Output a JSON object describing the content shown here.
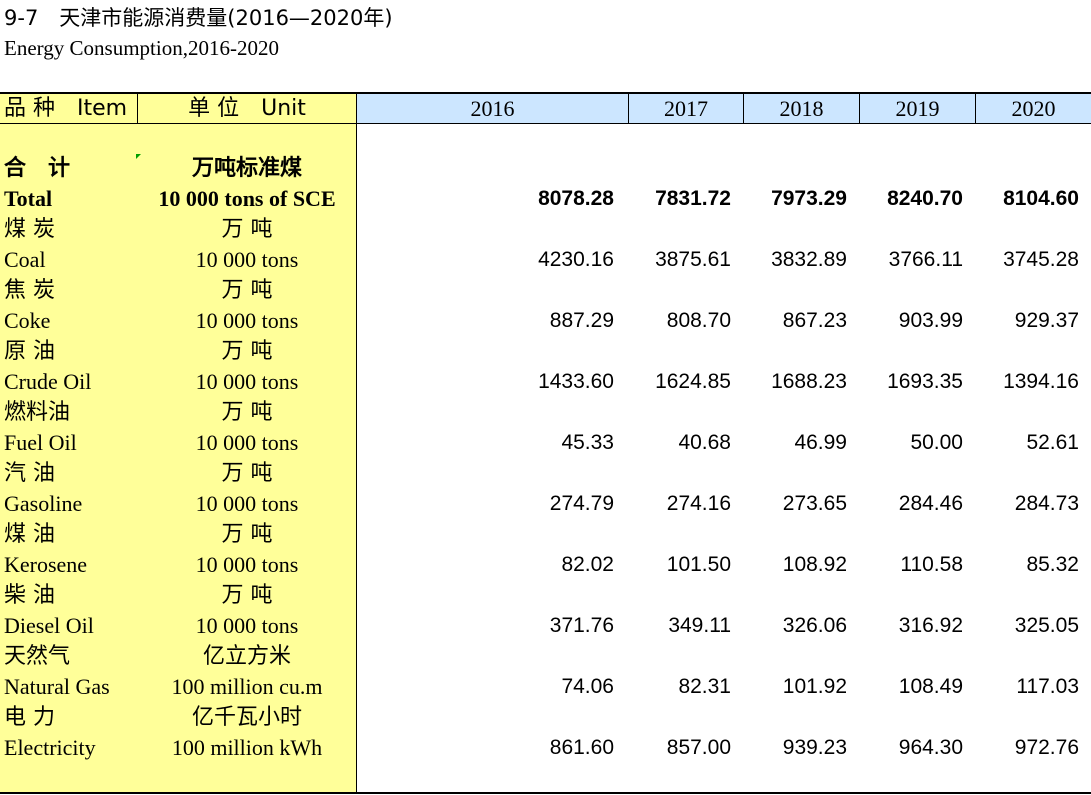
{
  "title": {
    "cn": "9-7　天津市能源消费量(2016—2020年)",
    "en": "Energy Consumption,2016-2020"
  },
  "header": {
    "item_label": "品 种　Item",
    "unit_label": "单 位　Unit",
    "years": [
      "2016",
      "2017",
      "2018",
      "2019",
      "2020"
    ]
  },
  "rows": [
    {
      "cn": "合　计",
      "en": "Total",
      "unit_cn": "万吨标准煤",
      "unit_en": "10 000 tons of SCE",
      "values": [
        "8078.28",
        "7831.72",
        "7973.29",
        "8240.70",
        "8104.60"
      ]
    },
    {
      "cn": "煤 炭",
      "en": "Coal",
      "unit_cn": "万 吨",
      "unit_en": "10 000 tons",
      "values": [
        "4230.16",
        "3875.61",
        "3832.89",
        "3766.11",
        "3745.28"
      ]
    },
    {
      "cn": "焦 炭",
      "en": "Coke",
      "unit_cn": "万 吨",
      "unit_en": "10 000 tons",
      "values": [
        "887.29",
        "808.70",
        "867.23",
        "903.99",
        "929.37"
      ]
    },
    {
      "cn": "原 油",
      "en": "Crude Oil",
      "unit_cn": "万 吨",
      "unit_en": "10 000 tons",
      "values": [
        "1433.60",
        "1624.85",
        "1688.23",
        "1693.35",
        "1394.16"
      ]
    },
    {
      "cn": "燃料油",
      "en": "Fuel Oil",
      "unit_cn": "万 吨",
      "unit_en": "10 000 tons",
      "values": [
        "45.33",
        "40.68",
        "46.99",
        "50.00",
        "52.61"
      ]
    },
    {
      "cn": "汽 油",
      "en": "Gasoline",
      "unit_cn": "万 吨",
      "unit_en": "10 000 tons",
      "values": [
        "274.79",
        "274.16",
        "273.65",
        "284.46",
        "284.73"
      ]
    },
    {
      "cn": "煤 油",
      "en": "Kerosene",
      "unit_cn": "万 吨",
      "unit_en": "10 000 tons",
      "values": [
        "82.02",
        "101.50",
        "108.92",
        "110.58",
        "85.32"
      ]
    },
    {
      "cn": "柴 油",
      "en": "Diesel Oil",
      "unit_cn": "万 吨",
      "unit_en": "10 000 tons",
      "values": [
        "371.76",
        "349.11",
        "326.06",
        "316.92",
        "325.05"
      ]
    },
    {
      "cn": "天然气",
      "en": "Natural Gas",
      "unit_cn": "亿立方米",
      "unit_en": "100 million cu.m",
      "values": [
        "74.06",
        "82.31",
        "101.92",
        "108.49",
        "117.03"
      ]
    },
    {
      "cn": "电 力",
      "en": "Electricity",
      "unit_cn": "亿千瓦小时",
      "unit_en": "100 million kWh",
      "values": [
        "861.60",
        "857.00",
        "939.23",
        "964.30",
        "972.76"
      ]
    }
  ],
  "colors": {
    "label_panel": "#ffff99",
    "year_header": "#cce6ff",
    "marker": "#00a000"
  }
}
